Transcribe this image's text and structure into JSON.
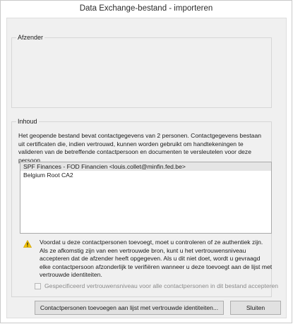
{
  "window": {
    "title": "Data Exchange-bestand - importeren"
  },
  "sender_group": {
    "legend": "Afzender"
  },
  "content_group": {
    "legend": "Inhoud",
    "intro_text": "Het geopende bestand bevat contactgegevens van 2 personen. Contactgegevens bestaan uit certificaten die, indien vertrouwd, kunnen worden gebruikt om handtekeningen te valideren van de betreffende contactpersoon en documenten te versleutelen voor deze persoon.",
    "contacts": [
      {
        "label": "SPF Finances - FOD Financien <louis.collet@minfin.fed.be>",
        "selected": true
      },
      {
        "label": "Belgium Root CA2",
        "selected": false
      }
    ],
    "warning_icon": "warning-triangle-icon",
    "warning_text": "Voordat u deze contactpersonen toevoegt, moet u controleren of ze authentiek zijn. Als ze afkomstig zijn van een vertrouwde bron, kunt u het vertrouwensniveau accepteren dat de afzender heeft opgegeven. Als u dit niet doet, wordt u gevraagd elke contactpersoon afzonderlijk te verifiëren wanneer u deze toevoegt aan de lijst met vertrouwde identiteiten.",
    "accept_trust_checkbox": {
      "label": "Gespecificeerd vertrouwensniveau voor alle contactpersonen in dit bestand accepteren",
      "checked": false,
      "enabled": false
    }
  },
  "buttons": {
    "add_label": "Contactpersonen toevoegen aan lijst met vertrouwde identiteiten...",
    "close_label": "Sluiten"
  },
  "colors": {
    "dialog_background": "#f0f0f0",
    "warning_yellow": "#f2c200",
    "selection": "#e5e5e5"
  }
}
